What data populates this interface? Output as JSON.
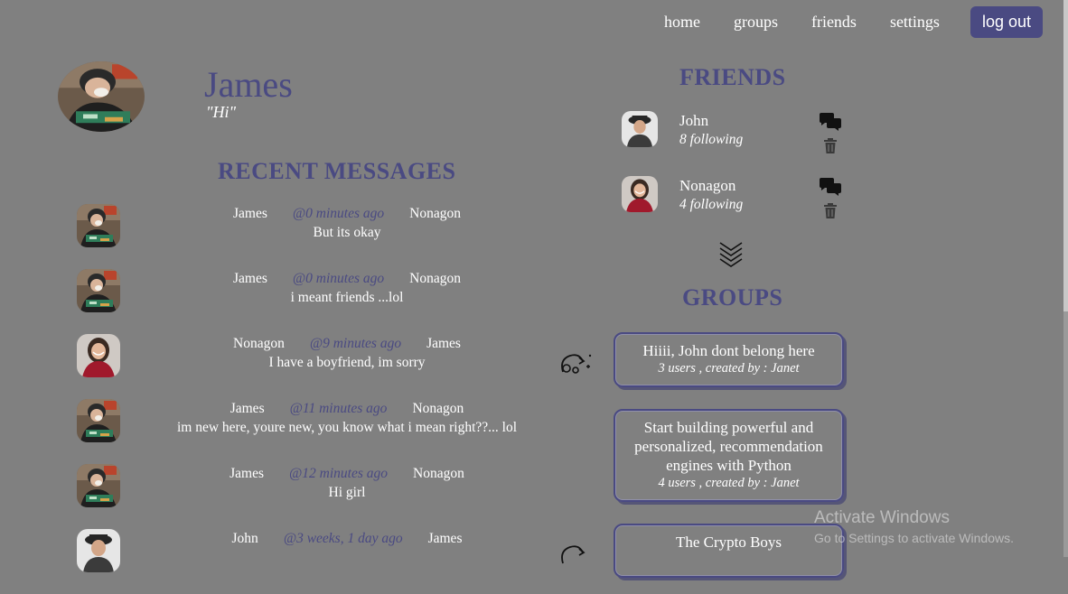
{
  "nav": {
    "items": [
      "home",
      "groups",
      "friends",
      "settings"
    ],
    "logout_label": "log out"
  },
  "profile": {
    "name": "James",
    "status": "\"Hi\""
  },
  "recent_messages": {
    "title": "RECENT MESSAGES",
    "items": [
      {
        "from": "James",
        "time": "@0 minutes ago",
        "to": "Nonagon",
        "text": "But its okay",
        "avatar": "james"
      },
      {
        "from": "James",
        "time": "@0 minutes ago",
        "to": "Nonagon",
        "text": "i meant friends ...lol",
        "avatar": "james"
      },
      {
        "from": "Nonagon",
        "time": "@9 minutes ago",
        "to": "James",
        "text": "I have a boyfriend, im sorry",
        "avatar": "nonagon"
      },
      {
        "from": "James",
        "time": "@11 minutes ago",
        "to": "Nonagon",
        "text": "im new here, youre new, you know what i mean right??... lol",
        "avatar": "james"
      },
      {
        "from": "James",
        "time": "@12 minutes ago",
        "to": "Nonagon",
        "text": "Hi girl",
        "avatar": "james"
      },
      {
        "from": "John",
        "time": "@3 weeks, 1 day ago",
        "to": "James",
        "text": "",
        "avatar": "john"
      }
    ]
  },
  "friends": {
    "title": "FRIENDS",
    "items": [
      {
        "name": "John",
        "following": "8 following",
        "avatar": "john"
      },
      {
        "name": "Nonagon",
        "following": "4 following",
        "avatar": "nonagon"
      }
    ],
    "chat_icon": "chat-bubbles-icon",
    "delete_icon": "trash-icon",
    "more_icon": "chevrons-down-icon"
  },
  "groups": {
    "title": "GROUPS",
    "items": [
      {
        "name": "Hiiii, John dont belong here",
        "info": "3 users , created by : Janet"
      },
      {
        "name": "Start building powerful and personalized, recommendation engines with Python",
        "info": "4 users , created by : Janet"
      },
      {
        "name": "The Crypto Boys",
        "info": ""
      }
    ]
  },
  "watermark": {
    "line1": "Activate Windows",
    "line2": "Go to Settings to activate Windows."
  },
  "colors": {
    "background": "#808080",
    "accent": "#4a4a82",
    "text": "#ffffff"
  }
}
